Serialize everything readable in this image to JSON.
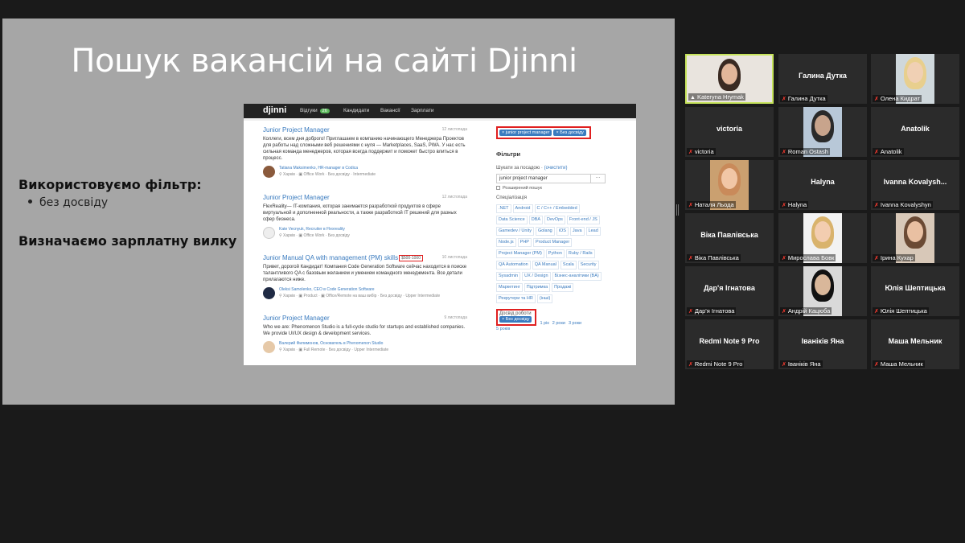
{
  "slide": {
    "title": "Пошук вакансій на сайті Djinni",
    "filter_heading": "Використовуємо фільтр:",
    "filter_bullet": "без досвіду",
    "salary_heading": "Визначаємо зарплатну вилку"
  },
  "djinni": {
    "logo": "djinni",
    "nav": {
      "reviews": "Відгуки",
      "reviews_count": "26",
      "candidates": "Кандидати",
      "vacancies": "Вакансії",
      "salaries": "Зарплати"
    },
    "jobs": [
      {
        "title": "Junior Project Manager",
        "date": "12 листопада",
        "desc": "Коллеги, всем дня доброго! Приглашаем в компанию начинающего Менеджера Проектов для работы над сложными веб решениями с нуля — Marketplaces, SaaS, PWA. У нас есть сильная команда менеджеров, которая всегда поддержит и поможет быстро влиться в процесс.",
        "author": "Tatiana Maksimenko, HR-manager в Codica",
        "meta": "⚲ Харків · ▣ Office Work · Без досвіду · Intermediate"
      },
      {
        "title": "Junior Project Manager",
        "date": "12 листопада",
        "desc": "FlexReality— IT-компания, которая занимается разработкой продуктов в сфере виртуальной и дополненной реальности, а также разработкой IT решений для разных сфер бизнеса.",
        "author": "Kate Vecnyuk, Recruiter в Flexreality",
        "meta": "⚲ Харків · ▣ Office Work · Без досвіду"
      },
      {
        "title": "Junior Manual QA with management (PM) skills",
        "salary": "$500-1000",
        "date": "10 листопада",
        "desc": "Привет, дорогой Кандидат! Компания Code Generation Software сейчас находится в поиске талантливого QA с базовым желанием и умением командного менеджмента. Все детали прилагаются ниже.",
        "author": "Oleksi Samolenko, CEO в Code Generation Software",
        "meta": "⚲ Харків · ▣ Product · ▣ Office/Remote на ваш вибір · Без досвіду · Upper Intermediate"
      },
      {
        "title": "Junior Project Manager",
        "date": "9 листопада",
        "desc": "Who we are: Phenomenon Studio is a full-cycle studio for startups and established companies. We provide UI/UX design & development services.",
        "author": "Валерий Филимонов, Основатель в Phenomenon Studio",
        "meta": "⚲ Харків · ▣ Full Remote · Без досвіду · Upper Intermediate"
      }
    ],
    "side": {
      "chip_1": "× junior project manager",
      "chip_2": "× Без досвіду",
      "filters_title": "Фільтри",
      "search_label": "Шукати за посадою",
      "search_clear": "(очистити)",
      "search_value": "junior project manager",
      "search_btn": "···",
      "advanced": "Розширений пошук",
      "spec_label": "Спеціалізація",
      "tags": [
        ".NET",
        "Android",
        "C / C++ / Embedded",
        "Data Science",
        "DBA",
        "DevOps",
        "Front-end / JS",
        "Gamedev / Unity",
        "Golang",
        "iOS",
        "Java",
        "Lead",
        "Node.js",
        "PHP",
        "Product Manager",
        "Project Manager (PM)",
        "Python",
        "Ruby / Rails",
        "QA Automation",
        "QA Manual",
        "Scala",
        "Security",
        "Sysadmin",
        "UX / Design",
        "Бізнес-аналітики (BA)",
        "Маркетинг",
        "Підтримка",
        "Продажі",
        "Рекрутери та HR",
        "(інші)"
      ],
      "exp_label": "Досвід роботи",
      "exp_selected": "× Без досвіду",
      "exp_1": "1 рік",
      "exp_2": "2 роки",
      "exp_3": "3 роки",
      "exp_5": "5 років"
    }
  },
  "participants": [
    {
      "name": "Kateryna Hrymak",
      "center": "",
      "active": true
    },
    {
      "name": "Галина Дутка",
      "center": "Галина Дутка"
    },
    {
      "name": "Олена Кидрат",
      "center": ""
    },
    {
      "name": "victoria",
      "center": "victoria"
    },
    {
      "name": "Roman Ostash",
      "center": ""
    },
    {
      "name": "Anatolik",
      "center": "Anatolik"
    },
    {
      "name": "Наталя Льода",
      "center": ""
    },
    {
      "name": "Halyna",
      "center": "Halyna"
    },
    {
      "name": "Ivanna Kovalyshyn",
      "center": "Ivanna  Kovalysh..."
    },
    {
      "name": "Віка Павлівська",
      "center": "Віка Павлівська"
    },
    {
      "name": "Мирослава Бовк",
      "center": ""
    },
    {
      "name": "Ірина Кухар",
      "center": ""
    },
    {
      "name": "Дар'я Ігнатова",
      "center": "Дар'я Ігнатова"
    },
    {
      "name": "Андрій Кацюба",
      "center": ""
    },
    {
      "name": "Юлія Шептицька",
      "center": "Юлія Шептицька"
    },
    {
      "name": "Redmi Note 9 Pro",
      "center": "Redmi Note 9 Pro"
    },
    {
      "name": "Іваніків Яна",
      "center": "Іваніків Яна"
    },
    {
      "name": "Маша Мельник",
      "center": "Маша Мельник"
    }
  ],
  "colors": {
    "background": "#1a1a1a",
    "slide": "#a6a6a6",
    "active_border": "#c6e35b",
    "muted_mic": "#ff3b30",
    "link": "#3a7bbf",
    "highlight": "#e02020"
  }
}
